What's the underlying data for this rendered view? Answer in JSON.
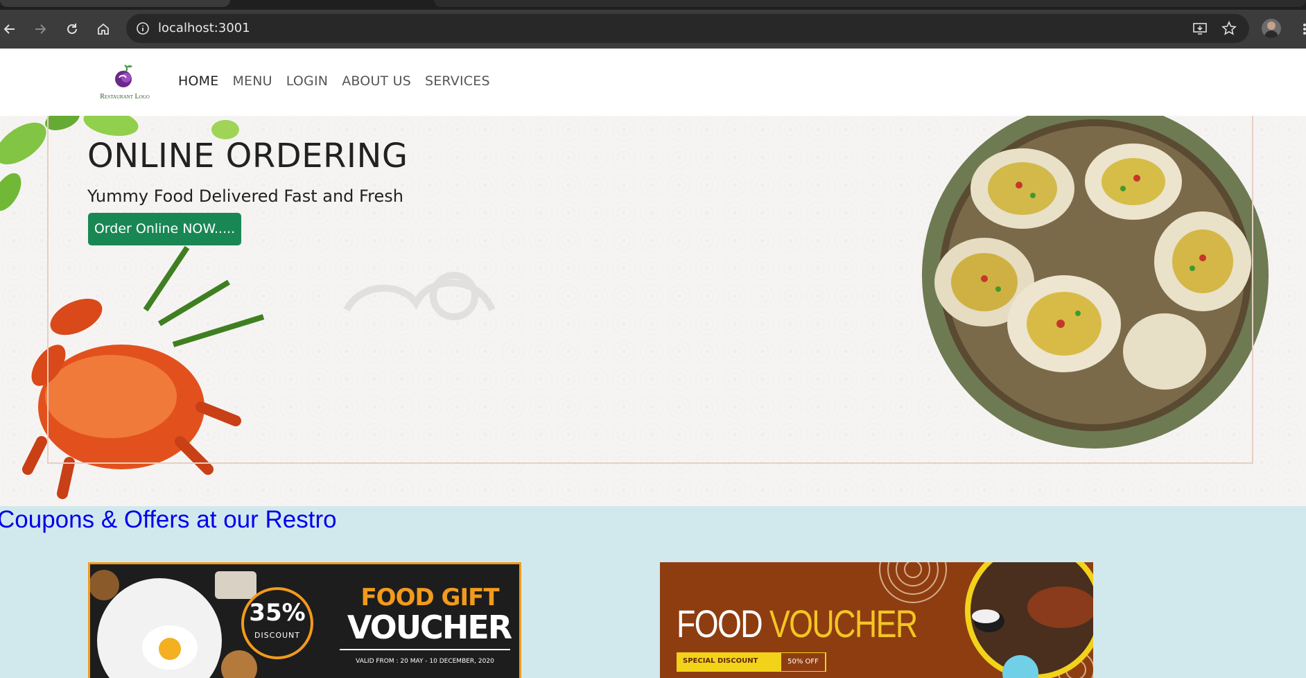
{
  "browser": {
    "url": "localhost:3001"
  },
  "nav": {
    "logo_text": "Restaurant Logo",
    "links": [
      "HOME",
      "MENU",
      "LOGIN",
      "ABOUT US",
      "SERVICES"
    ]
  },
  "hero": {
    "title": "ONLINE ORDERING",
    "subtitle": "Yummy Food Delivered Fast and Fresh",
    "cta": "Order Online NOW....."
  },
  "coupons": {
    "title": "Coupons & Offers at our Restro",
    "voucher1": {
      "discount": "35%",
      "discount_label": "DISCOUNT",
      "line1": "FOOD GIFT",
      "line2": "VOUCHER",
      "validity": "VALID FROM : 20 MAY - 10 DECEMBER, 2020"
    },
    "voucher2": {
      "word1": "FOOD",
      "word2": "VOUCHER",
      "tag": "SPECIAL DISCOUNT",
      "tag_value": "50% OFF"
    }
  },
  "colors": {
    "cta_green": "#198754",
    "link_blue": "#0000ee",
    "coupon_bg": "#d1e9ec",
    "voucher_orange": "#f39a1c"
  }
}
